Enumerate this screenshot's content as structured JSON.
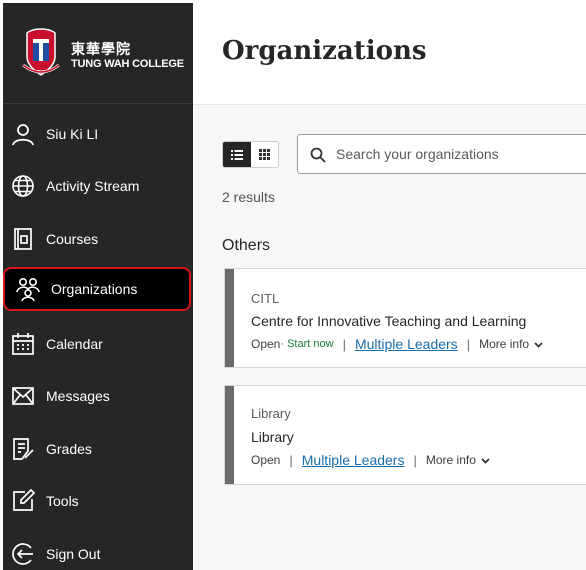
{
  "brand": {
    "name_cn": "東華學院",
    "name_en": "TUNG WAH COLLEGE"
  },
  "nav": {
    "items": [
      {
        "label": "Siu Ki LI",
        "icon": "user-icon"
      },
      {
        "label": "Activity Stream",
        "icon": "globe-icon"
      },
      {
        "label": "Courses",
        "icon": "courses-icon"
      },
      {
        "label": "Organizations",
        "icon": "organizations-icon",
        "active": true
      },
      {
        "label": "Calendar",
        "icon": "calendar-icon"
      },
      {
        "label": "Messages",
        "icon": "envelope-icon"
      },
      {
        "label": "Grades",
        "icon": "grades-icon"
      },
      {
        "label": "Tools",
        "icon": "tools-icon"
      },
      {
        "label": "Sign Out",
        "icon": "sign-out-icon"
      }
    ],
    "active_color": "#d9141c"
  },
  "page": {
    "title": "Organizations",
    "search_placeholder": "Search your organizations",
    "results_text": "2 results",
    "section_heading": "Others"
  },
  "organizations": [
    {
      "code": "CITL",
      "name": "Centre for Innovative Teaching and Learning",
      "status": "Open",
      "start_text": "Start now",
      "leaders": "Multiple Leaders",
      "more_info": "More info"
    },
    {
      "code": "Library",
      "name": "Library",
      "status": "Open",
      "leaders": "Multiple Leaders",
      "more_info": "More info"
    }
  ]
}
